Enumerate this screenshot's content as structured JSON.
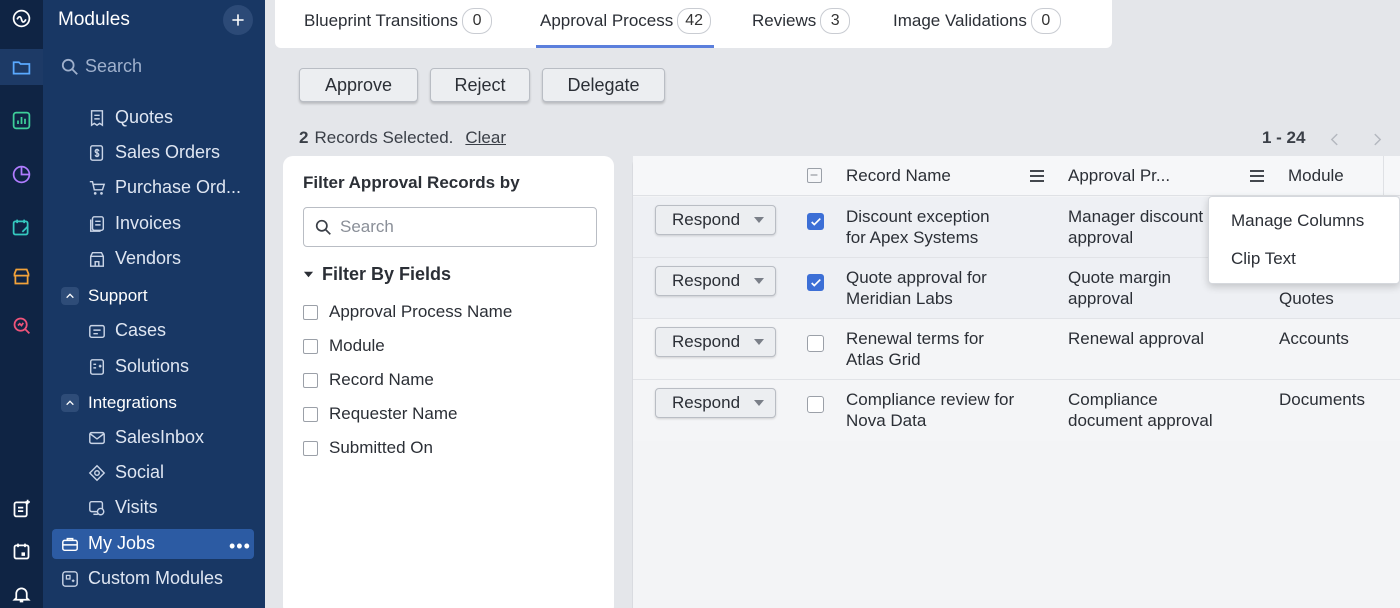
{
  "modules": {
    "title": "Modules",
    "search_placeholder": "Search",
    "items_top": [
      {
        "label": "Quotes",
        "icon": "quote-icon"
      },
      {
        "label": "Sales Orders",
        "icon": "sales-order-icon"
      },
      {
        "label": "Purchase Ord...",
        "icon": "cart-icon"
      },
      {
        "label": "Invoices",
        "icon": "invoice-icon"
      },
      {
        "label": "Vendors",
        "icon": "vendor-icon"
      }
    ],
    "support": {
      "label": "Support",
      "items": [
        {
          "label": "Cases"
        },
        {
          "label": "Solutions"
        }
      ]
    },
    "integrations": {
      "label": "Integrations",
      "items": [
        {
          "label": "SalesInbox"
        },
        {
          "label": "Social"
        },
        {
          "label": "Visits"
        }
      ]
    },
    "my_jobs": "My Jobs",
    "custom_modules": "Custom Modules"
  },
  "tabs": [
    {
      "label": "Blueprint Transitions",
      "count": "0"
    },
    {
      "label": "Approval Process",
      "count": "42",
      "active": true
    },
    {
      "label": "Reviews",
      "count": "3"
    },
    {
      "label": "Image Validations",
      "count": "0"
    }
  ],
  "actions": {
    "approve": "Approve",
    "reject": "Reject",
    "delegate": "Delegate"
  },
  "selection": {
    "count": "2",
    "text": "Records Selected.",
    "clear": "Clear"
  },
  "pagination": {
    "range": "1 - 24"
  },
  "filter": {
    "title": "Filter Approval Records by",
    "search_placeholder": "Search",
    "section": "Filter By Fields",
    "fields": [
      "Approval Process Name",
      "Module",
      "Record Name",
      "Requester Name",
      "Submitted On"
    ]
  },
  "table": {
    "headers": {
      "record_name": "Record Name",
      "approval_process": "Approval Pr...",
      "module": "Module"
    },
    "respond_label": "Respond",
    "rows": [
      {
        "record_line1": "Discount exception",
        "record_line2": "for Apex Systems",
        "process_line1": "Manager discount",
        "process_line2": "approval",
        "module": "",
        "selected": true
      },
      {
        "record_line1": "Quote approval for",
        "record_line2": "Meridian Labs",
        "process_line1": "Quote margin",
        "process_line2": "approval",
        "module": "Quotes",
        "selected": true
      },
      {
        "record_line1": "Renewal terms for",
        "record_line2": "Atlas Grid",
        "process_line1": "Renewal approval",
        "process_line2": "",
        "module": "Accounts",
        "selected": false
      },
      {
        "record_line1": "Compliance review for",
        "record_line2": "Nova Data",
        "process_line1": "Compliance",
        "process_line2": "document approval",
        "module": "Documents",
        "selected": false
      }
    ]
  },
  "context_menu": {
    "manage_columns": "Manage Columns",
    "clip_text": "Clip Text"
  },
  "colors": {
    "rail": "#0f2444",
    "sidebar": "#183764",
    "accent": "#3c6fd6",
    "active_item": "#2c5ba3"
  }
}
